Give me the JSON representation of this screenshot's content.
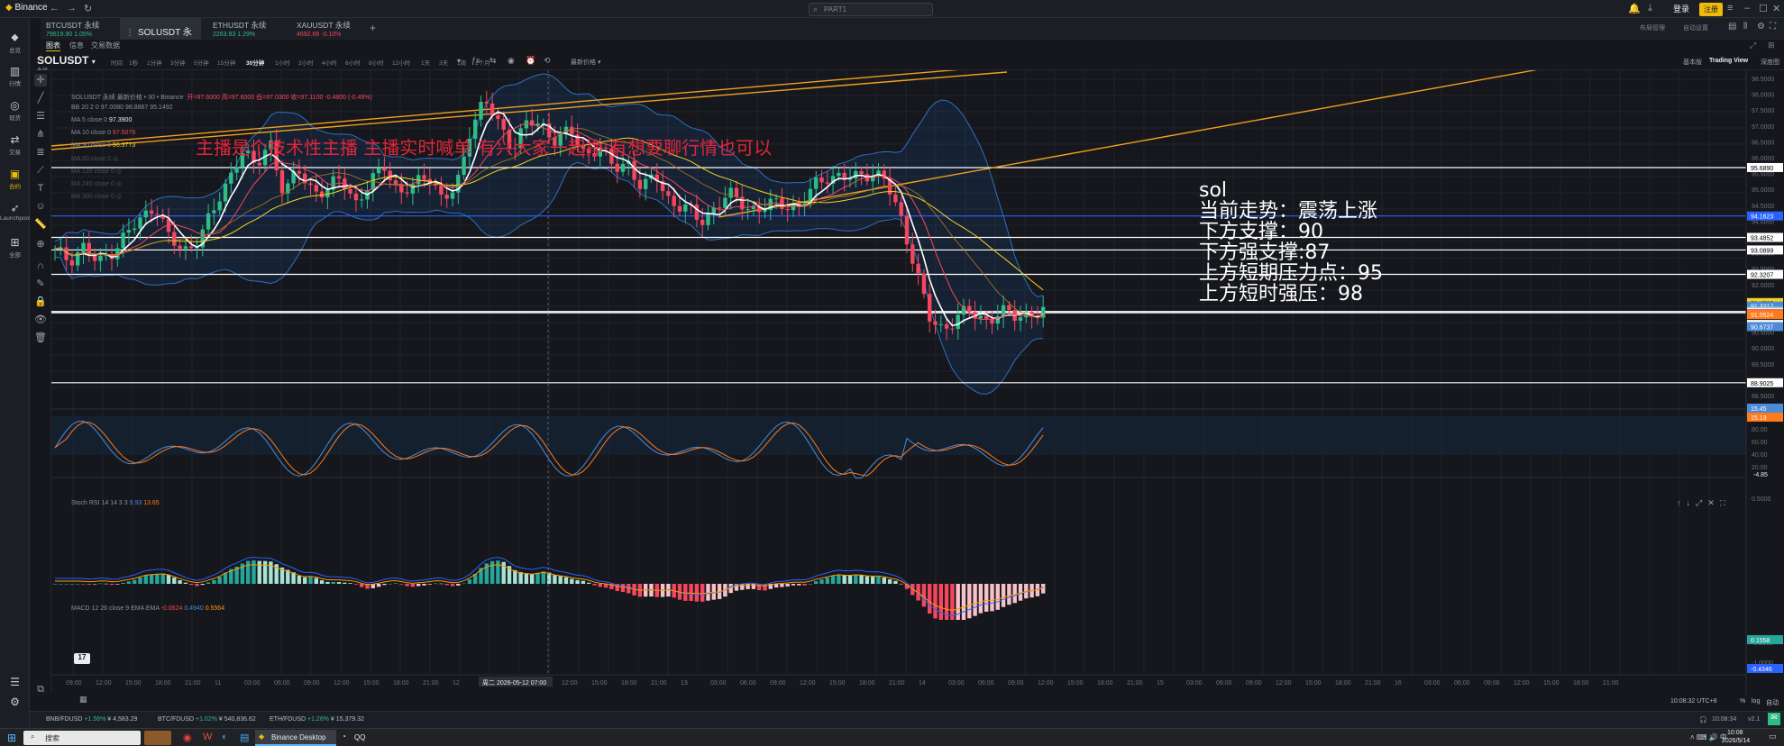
{
  "app": {
    "name": "Binance"
  },
  "search": {
    "placeholder": "PART1"
  },
  "header": {
    "login": "登录",
    "register": "注册"
  },
  "tabs": [
    {
      "symbol": "BTCUSDT 永续",
      "price": "79619.90",
      "change": "1.05%",
      "dir": "up"
    },
    {
      "symbol": "SOLUSDT 永续",
      "active": true
    },
    {
      "symbol": "ETHUSDT 永续",
      "price": "2263.93",
      "change": "1.29%",
      "dir": "up"
    },
    {
      "symbol": "XAUUSDT 永续",
      "price": "4692.66",
      "change": "-0.10%",
      "dir": "down"
    }
  ],
  "sidebar": [
    {
      "icon": "home-icon",
      "label": "总览"
    },
    {
      "icon": "chart-icon",
      "label": "行情"
    },
    {
      "icon": "coin-icon",
      "label": "现货"
    },
    {
      "icon": "exchange-icon",
      "label": "交易"
    },
    {
      "icon": "wallet-icon",
      "label": "合约"
    },
    {
      "icon": "rocket-icon",
      "label": "Launchpool"
    },
    {
      "icon": "grid-icon",
      "label": "全部"
    }
  ],
  "subtabs": [
    "图表",
    "信息",
    "交易数据"
  ],
  "toolbar": {
    "symbol": "SOLUSDT",
    "symbol_sub": "永续",
    "intervals": [
      "时间",
      "1秒",
      "1分钟",
      "3分钟",
      "5分钟",
      "15分钟",
      "30分钟",
      "1小时",
      "2小时",
      "4小时",
      "6小时",
      "8小时",
      "12小时",
      "1天",
      "3天",
      "1周",
      "1个月"
    ],
    "active_interval": "30分钟",
    "price_type": "最新价格",
    "right": [
      "基本版",
      "Trading View",
      "深度图"
    ]
  },
  "legend": {
    "main": "SOLUSDT 永续 最新价格 • 30 • Binance",
    "ohlc": "开=97.6000 高=97.6000 低=97.0300 收=97.1100 -0.4800 (-0.49%)",
    "indicators": [
      {
        "name": "BB 20 2 0",
        "values": "97.0080  98.8867  95.1492"
      },
      {
        "name": "MA 5 close 0",
        "values": "97.3900"
      },
      {
        "name": "MA 10 close 0",
        "values": "97.5079"
      },
      {
        "name": "MA 30 close 0",
        "values": "96.3773"
      },
      {
        "name": "MA 60 close 0",
        "values": ""
      },
      {
        "name": "MA 120 close 0",
        "values": ""
      },
      {
        "name": "MA 240 close 0",
        "values": ""
      },
      {
        "name": "MA 300 close 0",
        "values": ""
      }
    ],
    "stoch": "Stoch RSI 14 14 3 3",
    "stoch_k": "9.93",
    "stoch_d": "13.65",
    "macd": "MACD 12 26 close 9 EMA EMA",
    "macd_vals": [
      "-0.0624",
      "0.4940",
      "0.5564"
    ]
  },
  "banner": "主播是个技术性主播 主播实时喊单 有兴大家一起挣 有想要聊行情也可以",
  "overlay_note": {
    "title": "sol",
    "lines": [
      "当前走势：震荡上涨",
      "下方支撑：90",
      "下方强支撑:87",
      "上方短期压力点：95",
      "上方短时强压：98"
    ]
  },
  "price_axis": {
    "ticks": [
      "98.5000",
      "98.0000",
      "97.5000",
      "97.0000",
      "96.5000",
      "96.0000",
      "95.5000",
      "95.0000",
      "94.5000",
      "94.0000",
      "93.5000",
      "93.0000",
      "92.5000",
      "92.0000",
      "91.5000",
      "91.0000",
      "90.5000",
      "90.0000",
      "89.5000",
      "89.0000",
      "88.5000"
    ],
    "labels": [
      {
        "text": "95.6890",
        "color": "#ffffff",
        "fg": "#000000"
      },
      {
        "text": "94.1623",
        "color": "#2962ff",
        "fg": "#ffffff"
      },
      {
        "text": "93.4852",
        "color": "#ffffff",
        "fg": "#000000"
      },
      {
        "text": "93.0899",
        "color": "#ffffff",
        "fg": "#000000"
      },
      {
        "text": "92.3207",
        "color": "#ffffff",
        "fg": "#000000"
      },
      {
        "text": "91.4310",
        "color": "#f7d11f",
        "fg": "#000000"
      },
      {
        "text": "91.3217",
        "color": "#4b8bd8",
        "fg": "#ffffff"
      },
      {
        "text": "91.1490",
        "color": "#ffffff",
        "fg": "#000000"
      },
      {
        "text": "91.1300",
        "color": "#2ebd85",
        "fg": "#ffffff"
      },
      {
        "text": "91.1100",
        "color": "#ffffff",
        "fg": "#000000"
      },
      {
        "text": "91.0809",
        "color": "#f6465d",
        "fg": "#ffffff"
      },
      {
        "text": "91.0524",
        "color": "#ff7a1a",
        "fg": "#ffffff"
      },
      {
        "text": "90.7403",
        "color": "#ffffff",
        "fg": "#000000"
      },
      {
        "text": "90.6737",
        "color": "#4b8bd8",
        "fg": "#ffffff"
      },
      {
        "text": "88.9025",
        "color": "#ffffff",
        "fg": "#000000"
      }
    ],
    "stoch_ticks": [
      "80.00",
      "60.00",
      "40.00",
      "20.00"
    ],
    "stoch_labels": [
      {
        "text": "15.45",
        "color": "#4b8bd8"
      },
      {
        "text": "15.13",
        "color": "#ff7a1a"
      }
    ],
    "macd_ticks": [
      "0.5000",
      "-0.5000",
      "-1.0000"
    ],
    "macd_labels": [
      {
        "text": "0.1558",
        "color": "#26a69a"
      },
      {
        "text": "-0.4346",
        "color": "#2962ff"
      }
    ],
    "macd_top": "-4.85"
  },
  "time_axis": [
    "09:00",
    "12:00",
    "15:00",
    "18:00",
    "21:00",
    "11",
    "03:00",
    "06:00",
    "09:00",
    "12:00",
    "15:00",
    "18:00",
    "21:00",
    "12",
    "周二 2026-05-12  07:00",
    "12:00",
    "15:00",
    "18:00",
    "21:00",
    "13",
    "03:00",
    "06:00",
    "09:00",
    "12:00",
    "15:00",
    "18:00",
    "21:00",
    "14",
    "03:00",
    "06:00",
    "09:00",
    "12:00",
    "15:00",
    "18:00",
    "21:00",
    "15",
    "03:00",
    "06:00",
    "09:00",
    "12:00",
    "15:00",
    "18:00",
    "21:00",
    "16",
    "03:00",
    "06:00",
    "09:00",
    "12:00",
    "15:00",
    "18:00",
    "21:00"
  ],
  "status": {
    "time": "10:08:32 UTC+8",
    "pct": "%",
    "log": "log",
    "auto": "自动"
  },
  "ticker_strip": [
    {
      "pair": "BNB/FDUSD",
      "change": "+1.56%",
      "price": "¥ 4,583.29"
    },
    {
      "pair": "BTC/FDUSD",
      "change": "+1.02%",
      "price": "¥ 540,836.62"
    },
    {
      "pair": "ETH/FDUSD",
      "change": "+1.26%",
      "price": "¥ 15,379.32"
    }
  ],
  "taskbar": {
    "search": "搜索",
    "apps": [
      "Binance Desktop",
      "QQ"
    ],
    "clock": "10:08",
    "date": "2026/5/14",
    "inner_clock": "10:08:34",
    "version": "v2.1"
  },
  "top_right": {
    "links": [
      "布局管理",
      "自动设置"
    ]
  },
  "chart_data": {
    "type": "candlestick",
    "title": "SOLUSDT 永续 最新价格 • 30 • Binance",
    "interval": "30分钟",
    "ylim": [
      88.3,
      98.7
    ],
    "x_start": "2026-05-10 09:00",
    "x_end": "2026-05-14 10:00",
    "close_path": [
      93.0,
      92.8,
      93.2,
      92.6,
      93.1,
      93.6,
      94.0,
      94.6,
      93.4,
      93.0,
      93.5,
      94.2,
      95.2,
      96.3,
      95.6,
      96.6,
      94.8,
      95.6,
      95.0,
      94.9,
      95.4,
      94.6,
      95.1,
      95.8,
      94.9,
      95.0,
      95.6,
      94.7,
      94.9,
      97.0,
      97.8,
      97.0,
      96.4,
      97.1,
      97.0,
      96.6,
      96.8,
      96.1,
      96.4,
      95.6,
      95.9,
      95.0,
      95.4,
      94.6,
      94.4,
      94.0,
      94.4,
      94.8,
      94.6,
      94.3,
      94.5,
      94.6,
      94.4,
      95.1,
      95.5,
      95.3,
      95.4,
      95.6,
      95.2,
      94.2,
      92.7,
      90.9,
      90.6,
      91.0,
      91.1,
      90.9,
      91.1,
      91.0,
      91.1,
      91.1
    ],
    "horizontal_levels": [
      95.689,
      94.1623,
      93.4852,
      93.0899,
      92.3207,
      91.149,
      91.11,
      88.9025
    ],
    "bollinger": {
      "mid": 97.008,
      "upper": 98.8867,
      "lower": 95.1492
    },
    "stoch_rsi": {
      "k": 9.93,
      "d": 13.65
    },
    "macd": {
      "hist": -0.0624,
      "macd": 0.494,
      "signal": 0.5564
    }
  }
}
